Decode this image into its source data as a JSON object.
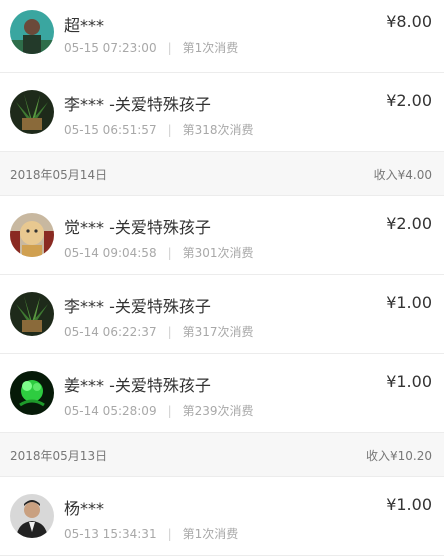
{
  "records": [
    {
      "name": "超***",
      "time": "05-15 07:23:00",
      "count": "第1次消费",
      "amount": "¥8.00",
      "avatar": "person-green-avatar"
    },
    {
      "name": "李*** -关爱特殊孩子",
      "time": "05-15 06:51:57",
      "count": "第318次消费",
      "amount": "¥2.00",
      "avatar": "plant-avatar"
    }
  ],
  "group_1": {
    "date": "2018年05月14日",
    "income": "收入¥4.00"
  },
  "records_1": [
    {
      "name": "觉*** -关爱特殊孩子",
      "time": "05-14 09:04:58",
      "count": "第301次消费",
      "amount": "¥2.00",
      "avatar": "child-avatar"
    },
    {
      "name": "李*** -关爱特殊孩子",
      "time": "05-14 06:22:37",
      "count": "第317次消费",
      "amount": "¥1.00",
      "avatar": "plant-avatar"
    },
    {
      "name": "姜*** -关爱特殊孩子",
      "time": "05-14 05:28:09",
      "count": "第239次消费",
      "amount": "¥1.00",
      "avatar": "green-flower-avatar"
    }
  ],
  "group_2": {
    "date": "2018年05月13日",
    "income": "收入¥10.20"
  },
  "records_2": [
    {
      "name": "杨***",
      "time": "05-13 15:34:31",
      "count": "第1次消费",
      "amount": "¥1.00",
      "avatar": "man-avatar"
    }
  ],
  "separator": "|"
}
